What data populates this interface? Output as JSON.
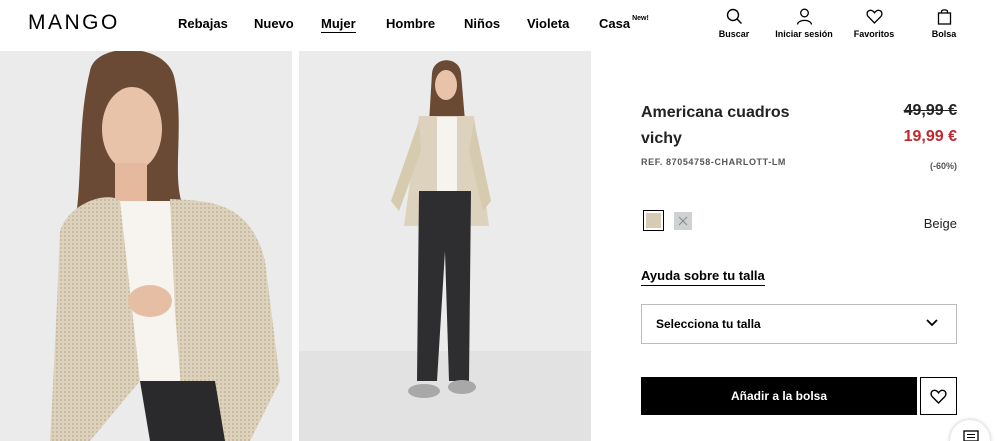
{
  "brand": {
    "logo": "MANGO"
  },
  "nav": [
    {
      "label": "Rebajas",
      "active": false
    },
    {
      "label": "Nuevo",
      "active": false
    },
    {
      "label": "Mujer",
      "active": true
    },
    {
      "label": "Hombre",
      "active": false
    },
    {
      "label": "Niños",
      "active": false
    },
    {
      "label": "Violeta",
      "active": false
    },
    {
      "label": "Casa",
      "badge": "New!",
      "active": false
    }
  ],
  "utility": {
    "search": {
      "label": "Buscar",
      "icon": "search-icon"
    },
    "login": {
      "label": "Iniciar sesión",
      "icon": "user-icon"
    },
    "favorites": {
      "label": "Favoritos",
      "icon": "heart-icon"
    },
    "bag": {
      "label": "Bolsa",
      "icon": "bag-icon"
    }
  },
  "product": {
    "name": "Americana cuadros vichy",
    "old_price": "49,99 €",
    "new_price": "19,99 €",
    "ref": "REF. 87054758-CHARLOTT-LM",
    "discount": "(-60%)",
    "selected_color": "Beige",
    "colors": [
      {
        "name": "beige",
        "hex": "#d8cbb3",
        "selected": true
      },
      {
        "name": "grey",
        "hex": "#cfd2d3",
        "selected": false
      }
    ]
  },
  "size": {
    "help_label": "Ayuda sobre tu talla",
    "select_label": "Selecciona tu talla"
  },
  "actions": {
    "add_to_bag": "Añadir a la bolsa"
  },
  "colors": {
    "price_sale": "#c1272d",
    "button_bg": "#000000",
    "photo_bg": "#ebebeb"
  }
}
